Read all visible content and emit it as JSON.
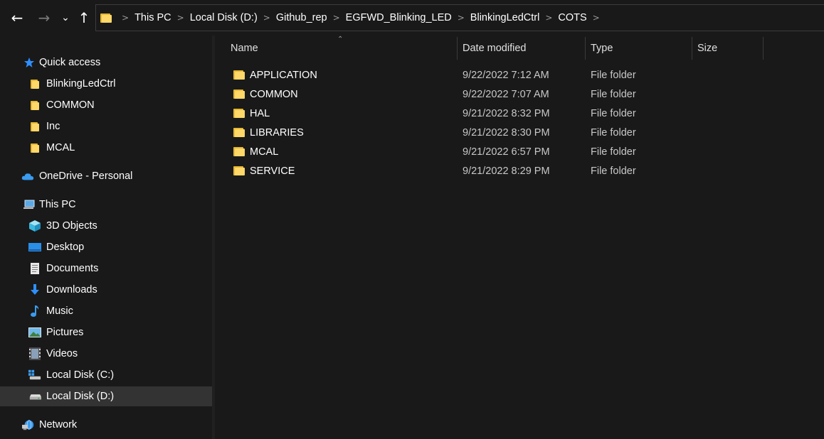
{
  "breadcrumb": [
    "This PC",
    "Local Disk (D:)",
    "Github_rep",
    "EGFWD_Blinking_LED",
    "BlinkingLedCtrl",
    "COTS"
  ],
  "sidebar": {
    "quick_access": "Quick access",
    "pinned": [
      "BlinkingLedCtrl",
      "COMMON",
      "Inc",
      "MCAL"
    ],
    "onedrive": "OneDrive - Personal",
    "this_pc": "This PC",
    "pc_items": [
      "3D Objects",
      "Desktop",
      "Documents",
      "Downloads",
      "Music",
      "Pictures",
      "Videos",
      "Local Disk (C:)",
      "Local Disk (D:)"
    ],
    "network": "Network",
    "selected": "Local Disk (D:)"
  },
  "columns": {
    "name": "Name",
    "date": "Date modified",
    "type": "Type",
    "size": "Size"
  },
  "files": [
    {
      "name": "APPLICATION",
      "date": "9/22/2022 7:12 AM",
      "type": "File folder"
    },
    {
      "name": "COMMON",
      "date": "9/22/2022 7:07 AM",
      "type": "File folder"
    },
    {
      "name": "HAL",
      "date": "9/21/2022 8:32 PM",
      "type": "File folder"
    },
    {
      "name": "LIBRARIES",
      "date": "9/21/2022 8:30 PM",
      "type": "File folder"
    },
    {
      "name": "MCAL",
      "date": "9/21/2022 6:57 PM",
      "type": "File folder"
    },
    {
      "name": "SERVICE",
      "date": "9/21/2022 8:29 PM",
      "type": "File folder"
    }
  ],
  "colors": {
    "background": "#191919",
    "folder": "#ffd869",
    "selected": "#333333",
    "star": "#2e8fff",
    "cloud": "#3a9bf0"
  },
  "icons": [
    "back-arrow-icon",
    "forward-arrow-icon",
    "chevron-down-icon",
    "up-arrow-icon",
    "folder-icon",
    "star-icon",
    "cloud-icon",
    "computer-icon",
    "cube-icon",
    "desktop-icon",
    "documents-icon",
    "download-icon",
    "music-icon",
    "pictures-icon",
    "videos-icon",
    "drive-icon",
    "network-icon"
  ]
}
